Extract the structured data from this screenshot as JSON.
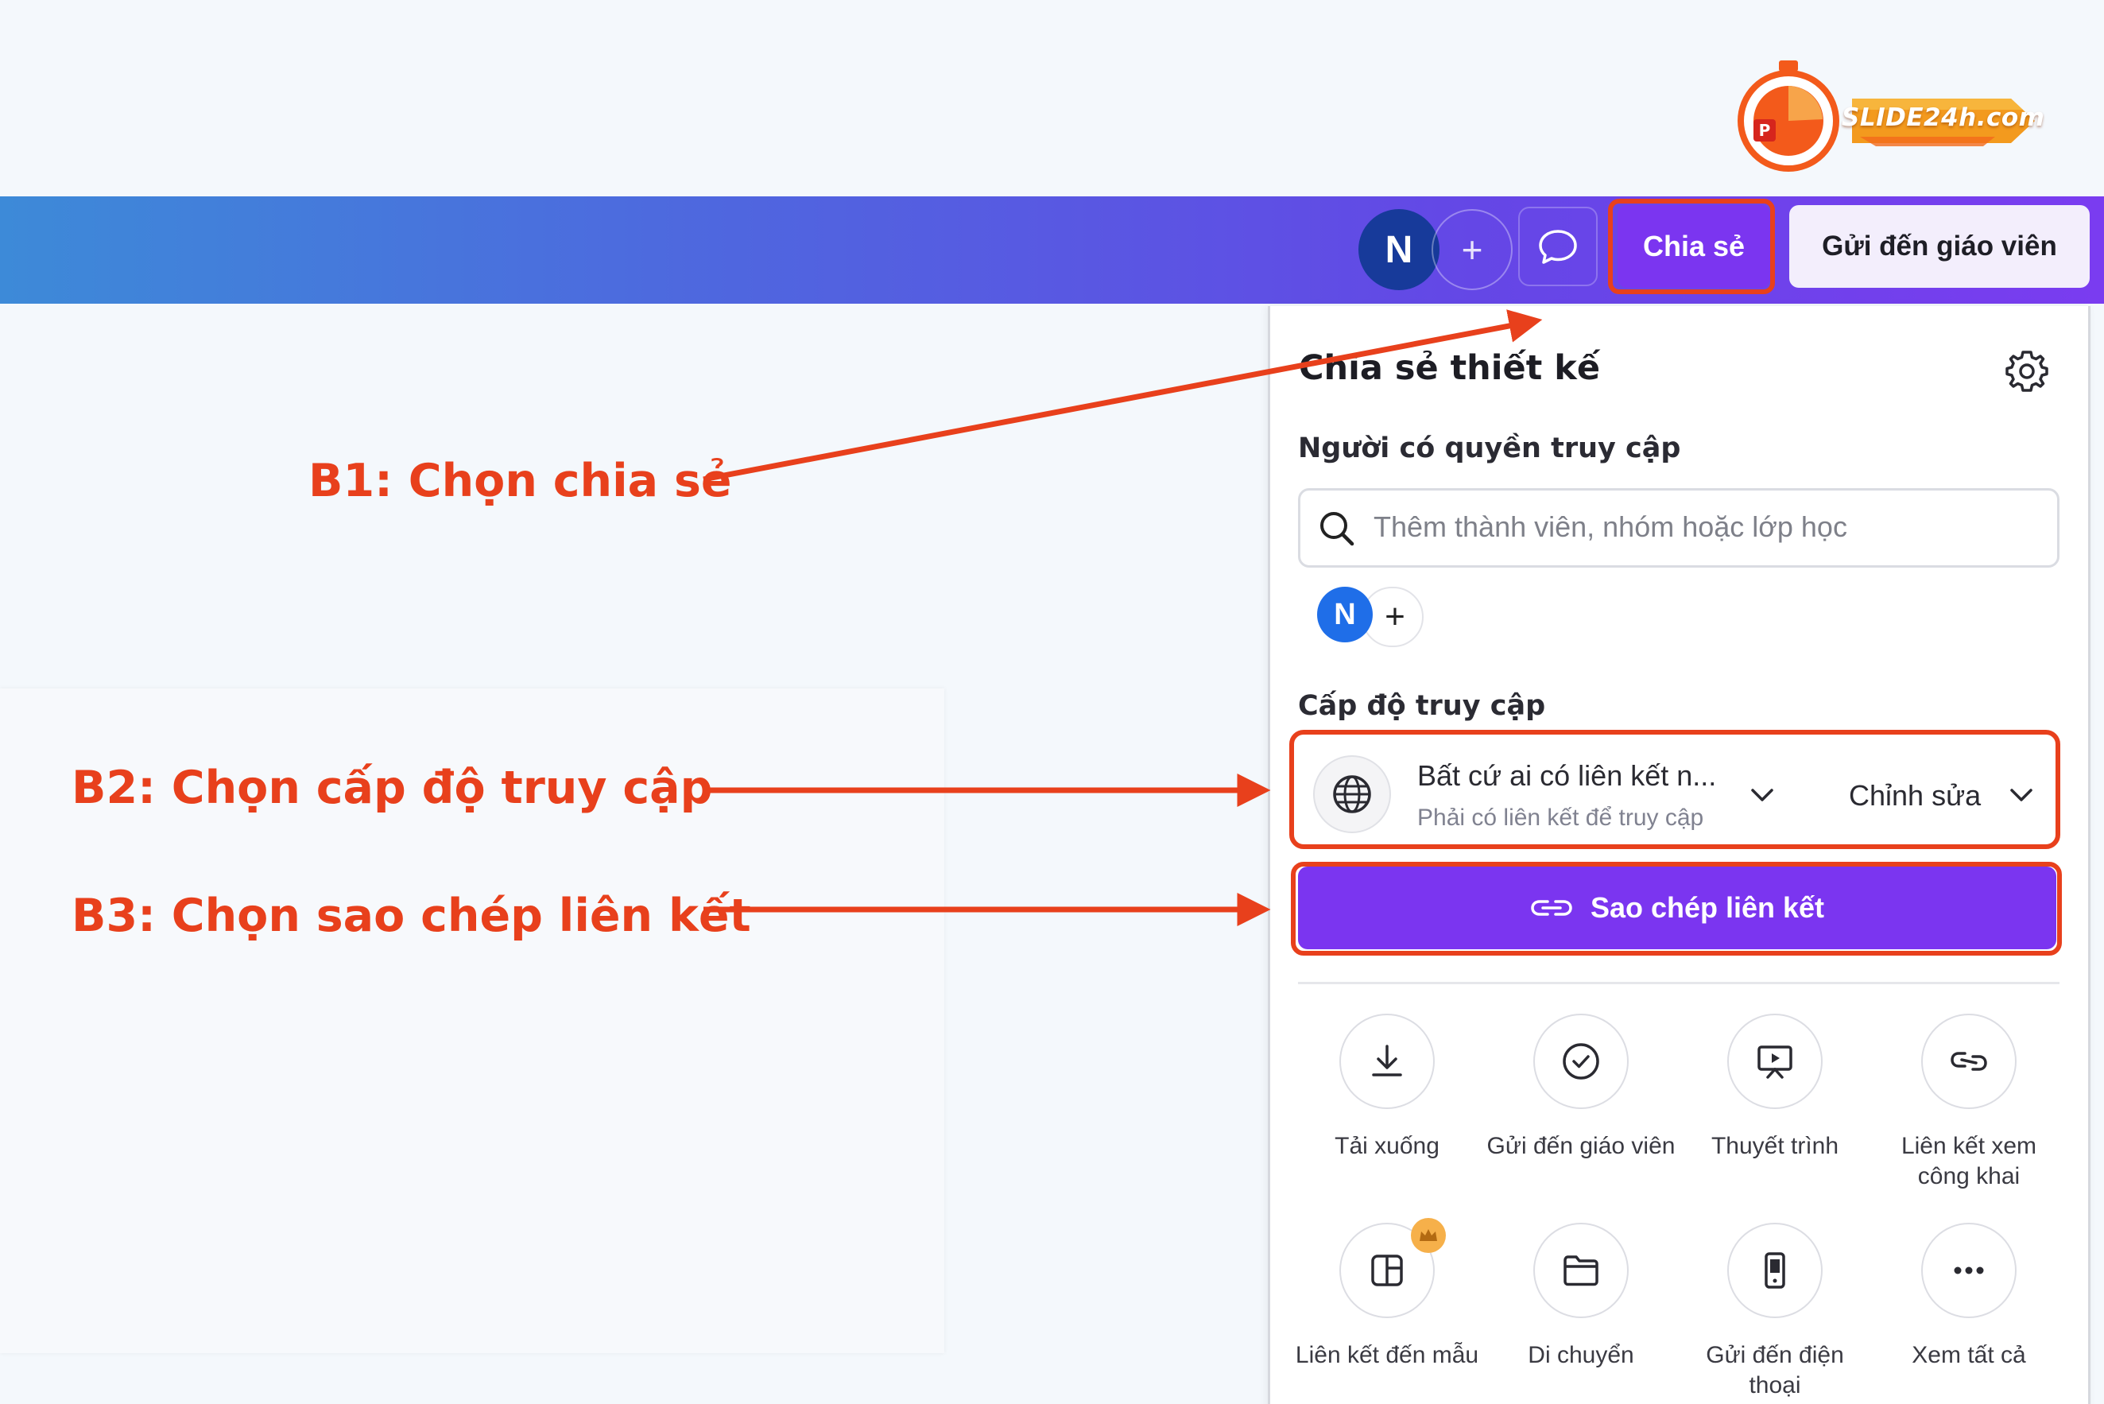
{
  "logo": {
    "text": "SLIDE24h.com"
  },
  "topbar": {
    "avatar_initial": "N",
    "add_symbol": "+",
    "share_label": "Chia sẻ",
    "send_teacher_label": "Gửi đến giáo viên"
  },
  "annotations": {
    "b1": "B1: Chọn chia sẻ",
    "b2": "B2: Chọn cấp độ truy cập",
    "b3": "B3: Chọn sao chép liên kết"
  },
  "panel": {
    "title": "Chia sẻ thiết kế",
    "access_people_label": "Người có quyền truy cập",
    "search_placeholder": "Thêm thành viên, nhóm hoặc lớp học",
    "member_initial": "N",
    "member_add_symbol": "+",
    "access_level_label": "Cấp độ truy cập",
    "access_option_title": "Bất cứ ai có liên kết n...",
    "access_option_subtitle": "Phải có liên kết để truy cập",
    "permission_label": "Chỉnh sửa",
    "copy_link_label": "Sao chép liên kết",
    "actions": [
      {
        "label": "Tải xuống",
        "icon": "download-icon"
      },
      {
        "label": "Gửi đến giáo viên",
        "icon": "check-circle-icon"
      },
      {
        "label": "Thuyết trình",
        "icon": "present-icon"
      },
      {
        "label": "Liên kết xem công khai",
        "icon": "link-icon"
      },
      {
        "label": "Liên kết đến mẫu",
        "icon": "template-icon"
      },
      {
        "label": "Di chuyển",
        "icon": "folder-icon"
      },
      {
        "label": "Gửi đến điện thoại",
        "icon": "phone-icon"
      },
      {
        "label": "Xem tất cả",
        "icon": "more-icon"
      }
    ]
  },
  "colors": {
    "accent_purple": "#7b35f0",
    "annotation_orange": "#e8401c",
    "avatar_dark_blue": "#173a9a",
    "member_blue": "#1f6ee8"
  }
}
